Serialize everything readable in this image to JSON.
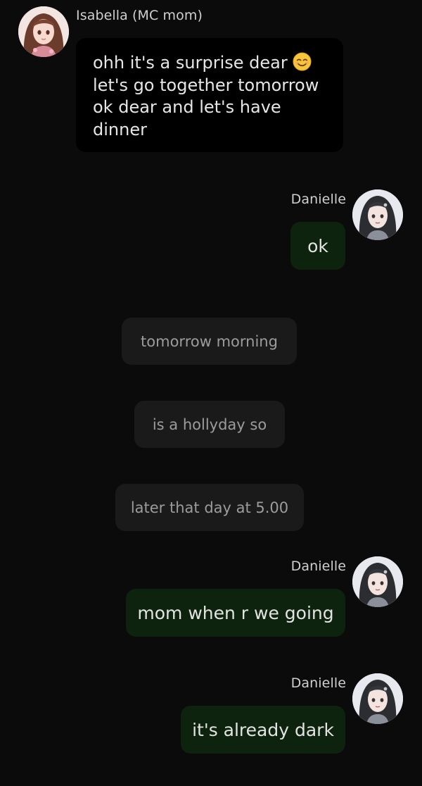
{
  "messages": [
    {
      "type": "character",
      "sender": "Isabella (MC mom)",
      "avatar_icon": "anime-girl-brown-hair-avatar",
      "lines": [
        "ohh it's a surprise dear",
        "let's go together tomorrow",
        "ok dear and let's have",
        "dinner"
      ],
      "emoji_icon": "smiling-face-emoji"
    },
    {
      "type": "player",
      "sender": "Danielle",
      "avatar_icon": "anime-girl-dark-hair-avatar",
      "text": "ok"
    },
    {
      "type": "narration",
      "text": "tomorrow morning"
    },
    {
      "type": "narration",
      "text": "is a hollyday so"
    },
    {
      "type": "narration",
      "text": "later that day at 5.00"
    },
    {
      "type": "player",
      "sender": "Danielle",
      "avatar_icon": "anime-girl-dark-hair-avatar",
      "text": "mom when r we going"
    },
    {
      "type": "player",
      "sender": "Danielle",
      "avatar_icon": "anime-girl-dark-hair-avatar",
      "text": "it's already dark"
    }
  ],
  "colors": {
    "background": "#0b0b0b",
    "mom_bubble": "#000000",
    "player_bubble": "#0d230d",
    "narration_bubble": "#1a1a1a",
    "narration_text": "#9c9c9c"
  }
}
